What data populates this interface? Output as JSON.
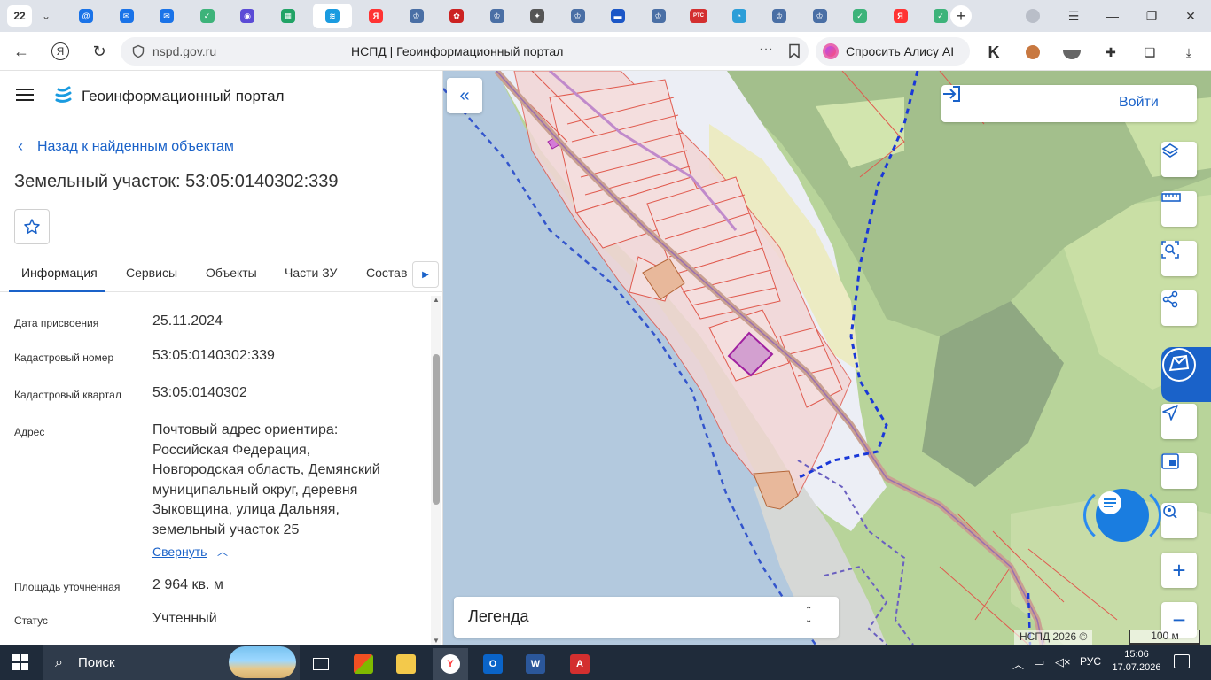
{
  "browser": {
    "tab_count": "22",
    "url_host": "nspd.gov.ru",
    "page_title": "НСПД | Геоинформационный портал",
    "alice_button": "Спросить Алису AI",
    "tab_favicons": [
      {
        "icon": "mail-at-icon",
        "color": "#1a73e8",
        "glyph": "@"
      },
      {
        "icon": "mail-icon",
        "color": "#1a73e8",
        "glyph": "✉"
      },
      {
        "icon": "mail-icon",
        "color": "#1a73e8",
        "glyph": "✉"
      },
      {
        "icon": "gosuslugi-check-icon",
        "color": "#3db37a",
        "glyph": "✓"
      },
      {
        "icon": "messenger-icon",
        "color": "#5b4bd6",
        "glyph": "◉"
      },
      {
        "icon": "table-icon",
        "color": "#21a366",
        "glyph": "▦"
      },
      {
        "icon": "nspd-logo-icon",
        "color": "#1a9be0",
        "glyph": "≋"
      },
      {
        "icon": "yandex-icon",
        "color": "#f33",
        "glyph": "Я"
      },
      {
        "icon": "emblem-icon",
        "color": "#4a6fa5",
        "glyph": "♔"
      },
      {
        "icon": "tatarstan-emblem-icon",
        "color": "#c22",
        "glyph": "✿"
      },
      {
        "icon": "emblem-icon",
        "color": "#4a6fa5",
        "glyph": "♔"
      },
      {
        "icon": "coat-of-arms-icon",
        "color": "#555",
        "glyph": "✦"
      },
      {
        "icon": "emblem-icon",
        "color": "#4a6fa5",
        "glyph": "♔"
      },
      {
        "icon": "russia-flag-icon",
        "color": "#1c57c7",
        "glyph": "▬"
      },
      {
        "icon": "emblem-icon",
        "color": "#4a6fa5",
        "glyph": "♔"
      },
      {
        "icon": "rts-icon",
        "color": "#d32f2f",
        "glyph": "РТС"
      },
      {
        "icon": "pie-icon",
        "color": "#2c9ed8",
        "glyph": "◔"
      },
      {
        "icon": "emblem-icon",
        "color": "#4a6fa5",
        "glyph": "♔"
      },
      {
        "icon": "emblem-icon",
        "color": "#4a6fa5",
        "glyph": "♔"
      },
      {
        "icon": "gosuslugi-check-icon",
        "color": "#3db37a",
        "glyph": "✓"
      },
      {
        "icon": "yandex-icon",
        "color": "#f33",
        "glyph": "Я"
      },
      {
        "icon": "gosuslugi-check-icon",
        "color": "#3db37a",
        "glyph": "✓"
      }
    ]
  },
  "portal": {
    "name": "Геоинформационный портал",
    "back_link": "Назад к найденным объектам",
    "title": "Земельный участок: 53:05:0140302:339",
    "tabs": [
      "Информация",
      "Сервисы",
      "Объекты",
      "Части ЗУ",
      "Состав"
    ],
    "fields": [
      {
        "label": "Дата присвоения",
        "value": "25.11.2024"
      },
      {
        "label": "Кадастровый номер",
        "value": "53:05:0140302:339"
      },
      {
        "label": "Кадастровый квартал",
        "value": "53:05:0140302"
      },
      {
        "label": "Адрес",
        "value_lines": [
          "Почтовый адрес ориентира:",
          "Российская Федерация,",
          "Новгородская область, Демянский",
          "муниципальный округ, деревня",
          "Зыковщина, улица Дальняя,",
          "земельный участок 25"
        ]
      },
      {
        "label": "Площадь уточненная",
        "value": "2 964 кв. м"
      },
      {
        "label": "Статус",
        "value": "Учтенный"
      }
    ],
    "collapse_link": "Свернуть"
  },
  "map": {
    "login": "Войти",
    "legend": "Легенда",
    "copyright": "НСПД 2026 ©",
    "scale": "100 м"
  },
  "taskbar": {
    "search": "Поиск",
    "lang": "РУС",
    "time": "15:06",
    "date": "17.07.2026"
  },
  "colors": {
    "accent": "#1a62c9",
    "water": "#b2c9df",
    "forest": "#a9c98a",
    "parcel_fill": "#f2d6d6",
    "parcel_stroke": "#e05a4e",
    "selected_parcel": "#a020a0"
  }
}
